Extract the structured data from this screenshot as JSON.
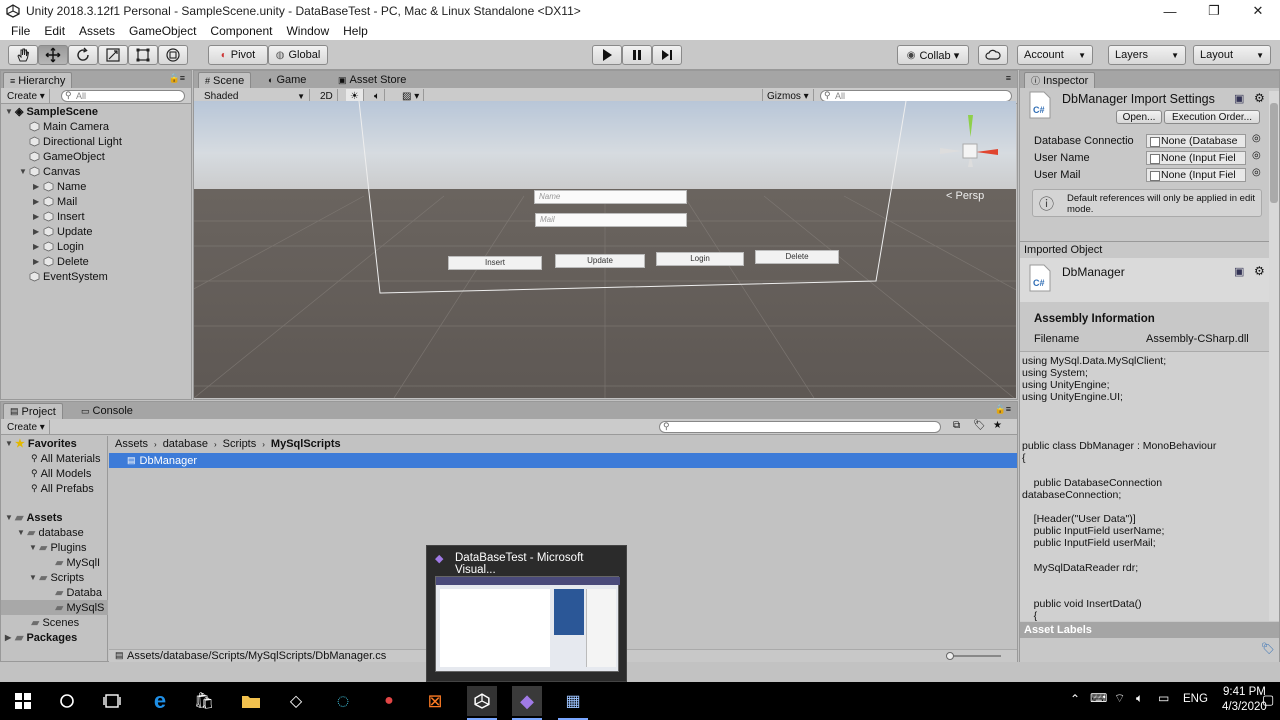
{
  "window": {
    "title": "Unity 2018.3.12f1 Personal - SampleScene.unity - DataBaseTest - PC, Mac & Linux Standalone <DX11>",
    "controls": [
      "—",
      "❐",
      "✕"
    ]
  },
  "menu": [
    "File",
    "Edit",
    "Assets",
    "GameObject",
    "Component",
    "Window",
    "Help"
  ],
  "toolbar": {
    "pivot": "Pivot",
    "global": "Global",
    "collab": "Collab ▾",
    "account": "Account",
    "layers": "Layers",
    "layout": "Layout"
  },
  "hierarchy": {
    "tab": "Hierarchy",
    "create": "Create ▾",
    "search_placeholder": "All",
    "scene": "SampleScene",
    "items": [
      "Main Camera",
      "Directional Light",
      "GameObject",
      "Canvas",
      "Name",
      "Mail",
      "Insert",
      "Update",
      "Login",
      "Delete",
      "EventSystem"
    ]
  },
  "scene": {
    "tabs": [
      "Scene",
      "Game",
      "Asset Store"
    ],
    "shading": "Shaded",
    "mode_2d": "2D",
    "gizmos": "Gizmos ▾",
    "search_placeholder": "All",
    "persp": "< Persp",
    "name_placeholder": "Name",
    "mail_placeholder": "Mail",
    "buttons": [
      "Insert",
      "Update",
      "Login",
      "Delete"
    ]
  },
  "project": {
    "tabs": [
      "Project",
      "Console"
    ],
    "create": "Create ▾",
    "favorites": "Favorites",
    "favorite_items": [
      "All Materials",
      "All Models",
      "All Prefabs"
    ],
    "assets": "Assets",
    "tree": [
      "database",
      "Plugins",
      "MySqlI",
      "Scripts",
      "Databa",
      "MySqlS",
      "Scenes"
    ],
    "packages": "Packages",
    "breadcrumb": [
      "Assets",
      "database",
      "Scripts",
      "MySqlScripts"
    ],
    "selected_file": "DbManager",
    "status_path": "Assets/database/Scripts/MySqlScripts/DbManager.cs"
  },
  "inspector": {
    "tab": "Inspector",
    "title": "DbManager Import Settings",
    "open": "Open...",
    "execution_order": "Execution Order...",
    "fields": [
      {
        "label": "Database Connectio",
        "value": "None (Database"
      },
      {
        "label": "User Name",
        "value": "None (Input Fiel"
      },
      {
        "label": "User Mail",
        "value": "None (Input Fiel"
      }
    ],
    "info": "Default references will only be applied in edit mode.",
    "imported_object": "Imported Object",
    "object_name": "DbManager",
    "assembly_header": "Assembly Information",
    "filename_label": "Filename",
    "filename_value": "Assembly-CSharp.dll",
    "code": [
      "using MySql.Data.MySqlClient;",
      "using System;",
      "using UnityEngine;",
      "using UnityEngine.UI;",
      "public class DbManager : MonoBehaviour",
      "{",
      "    public DatabaseConnection",
      "databaseConnection;",
      "    [Header(\"User Data\")]",
      "    public InputField userName;",
      "    public InputField userMail;",
      "    MySqlDataReader rdr;",
      "    public void InsertData()",
      "    {"
    ],
    "asset_labels": "Asset Labels",
    "csharp": "C#"
  },
  "thumbnail": {
    "title": "DataBaseTest - Microsoft Visual..."
  },
  "taskbar": {
    "time": "9:41 PM",
    "date": "4/3/2020",
    "lang": "ENG"
  }
}
